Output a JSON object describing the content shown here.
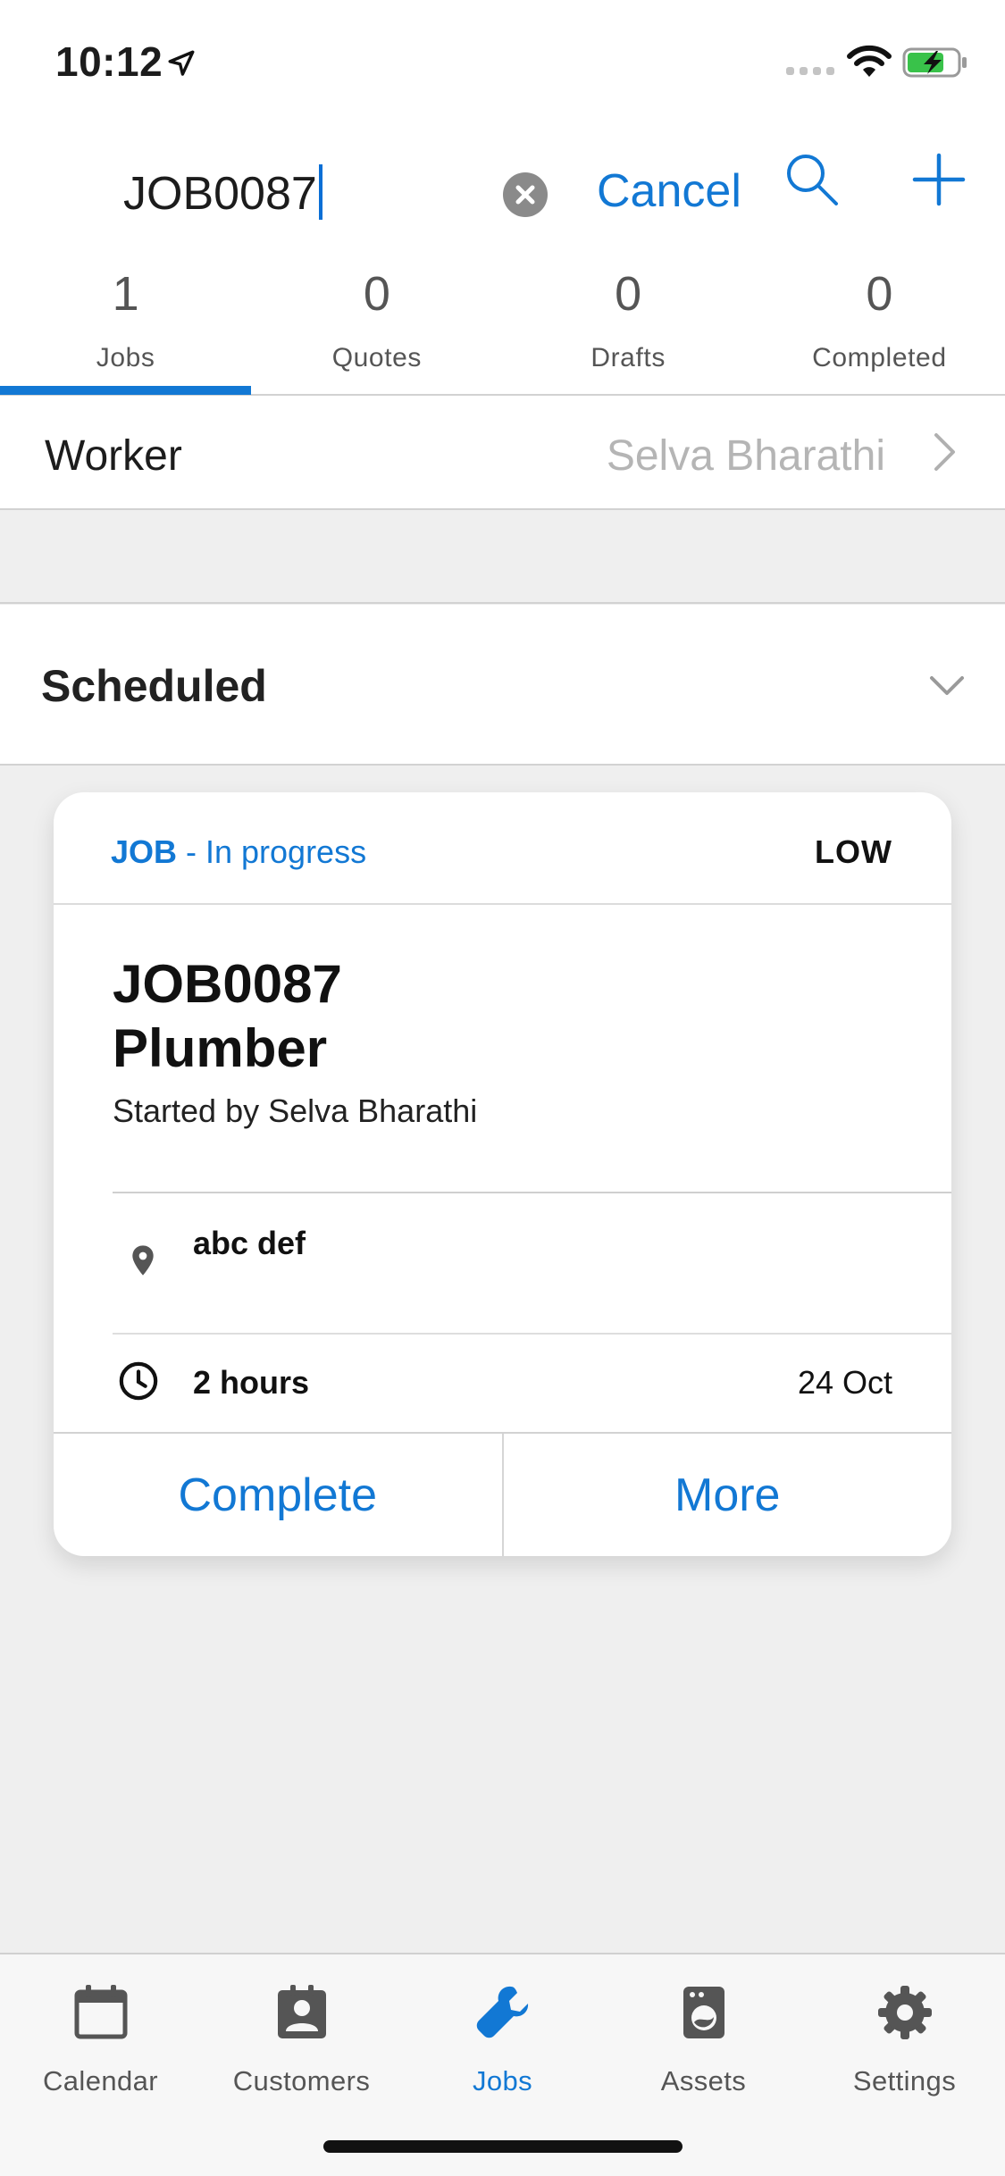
{
  "status_bar": {
    "time": "10:12"
  },
  "search": {
    "query": "JOB0087",
    "cancel_label": "Cancel"
  },
  "tabs": [
    {
      "count": "1",
      "label": "Jobs",
      "active": true
    },
    {
      "count": "0",
      "label": "Quotes",
      "active": false
    },
    {
      "count": "0",
      "label": "Drafts",
      "active": false
    },
    {
      "count": "0",
      "label": "Completed",
      "active": false
    }
  ],
  "worker": {
    "label": "Worker",
    "value": "Selva Bharathi"
  },
  "section": {
    "title": "Scheduled"
  },
  "job_card": {
    "type": "JOB",
    "status": "- In progress",
    "priority": "LOW",
    "id": "JOB0087",
    "title": "Plumber",
    "started_by": "Started by Selva Bharathi",
    "address": "abc def",
    "duration": "2 hours",
    "date": "24 Oct",
    "complete_label": "Complete",
    "more_label": "More"
  },
  "bottom_nav": [
    {
      "label": "Calendar",
      "icon": "calendar-icon",
      "active": false
    },
    {
      "label": "Customers",
      "icon": "contact-badge-icon",
      "active": false
    },
    {
      "label": "Jobs",
      "icon": "wrench-icon",
      "active": true
    },
    {
      "label": "Assets",
      "icon": "washing-machine-icon",
      "active": false
    },
    {
      "label": "Settings",
      "icon": "gear-icon",
      "active": false
    }
  ],
  "colors": {
    "accent": "#1278d4",
    "background": "#efefef",
    "muted_text": "#b5b5b5"
  }
}
